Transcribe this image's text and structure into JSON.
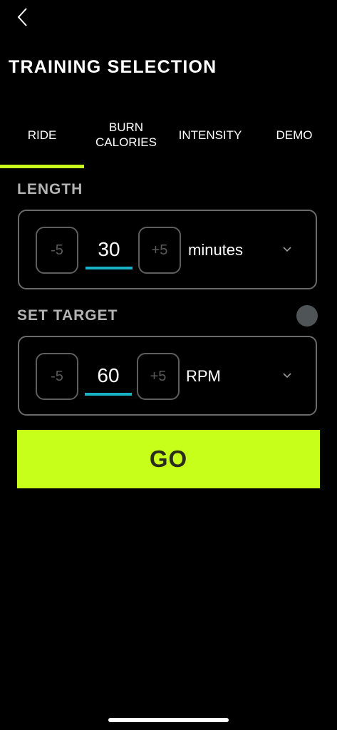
{
  "header": {
    "back_icon": "chevron-left-icon",
    "title": "TRAINING SELECTION"
  },
  "tabs": [
    {
      "label": "RIDE",
      "active": true
    },
    {
      "label": "BURN\nCALORIES",
      "active": false
    },
    {
      "label": "INTENSITY",
      "active": false
    },
    {
      "label": "DEMO",
      "active": false
    }
  ],
  "length": {
    "label": "LENGTH",
    "decrement_label": "-5",
    "value": "30",
    "increment_label": "+5",
    "unit": "minutes"
  },
  "target": {
    "label": "SET TARGET",
    "decrement_label": "-5",
    "value": "60",
    "increment_label": "+5",
    "unit": "RPM"
  },
  "go_button": {
    "label": "GO"
  },
  "colors": {
    "accent": "#c8ff1a",
    "input_underline": "#18b2c6",
    "background": "#000000"
  }
}
